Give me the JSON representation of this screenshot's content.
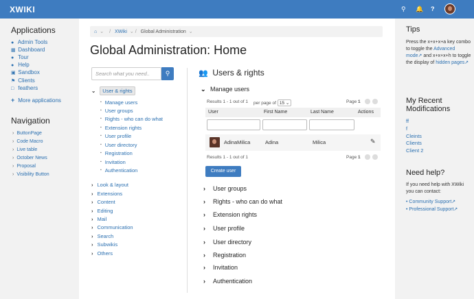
{
  "topbar": {
    "logo": "XWIKI",
    "search_icon": "search-icon",
    "bell_icon": "bell-icon",
    "help_icon": "question-icon",
    "help_label": "?"
  },
  "applications": {
    "heading": "Applications",
    "items": [
      {
        "label": "Admin Tools",
        "icon": "globe-icon"
      },
      {
        "label": "Dashboard",
        "icon": "dashboard-icon"
      },
      {
        "label": "Tour",
        "icon": "shoe-icon"
      },
      {
        "label": "Help",
        "icon": "help-icon"
      },
      {
        "label": "Sandbox",
        "icon": "sandbox-icon"
      },
      {
        "label": "Clients",
        "icon": "flag-icon"
      },
      {
        "label": "feathers",
        "icon": "document-icon"
      }
    ],
    "more": "More applications"
  },
  "navigation": {
    "heading": "Navigation",
    "items": [
      "ButtonPage",
      "Code Macro",
      "Live table",
      "October News",
      "Proposal",
      "Visibility Button"
    ]
  },
  "breadcrumb": [
    "XWiki",
    "Global Administration"
  ],
  "page_title": "Global Administration: Home",
  "search": {
    "placeholder": "Search what you need.."
  },
  "tree": {
    "selected": "User & rights",
    "children": [
      "Manage users",
      "User groups",
      "Rights - who can do what",
      "Extension rights",
      "User profile",
      "User directory",
      "Registration",
      "Invitation",
      "Authentication"
    ],
    "others": [
      "Look & layout",
      "Extensions",
      "Content",
      "Editing",
      "Mail",
      "Communication",
      "Search",
      "Subwikis",
      "Others"
    ]
  },
  "section": {
    "title": "Users & rights",
    "icon": "users-icon"
  },
  "manage_users": {
    "title": "Manage users",
    "results": "Results 1 - 1 out of 1",
    "per_page_label": "per page of",
    "per_page": "15",
    "page_label": "Page",
    "page_num": "1",
    "columns": [
      "User",
      "First Name",
      "Last Name",
      "Actions"
    ],
    "rows": [
      {
        "user": "AdinaMilica",
        "first": "Adina",
        "last": "Milica"
      }
    ],
    "create": "Create user"
  },
  "accordion": [
    "User groups",
    "Rights - who can do what",
    "Extension rights",
    "User profile",
    "User directory",
    "Registration",
    "Invitation",
    "Authentication"
  ],
  "tips": {
    "heading": "Tips",
    "text1": "Press the x+x+x+a key combo to toggle the",
    "link1": "Advanced mode",
    "text2": "and x+x+x+h to toggle the display of",
    "link2": "hidden pages"
  },
  "recent": {
    "heading": "My Recent Modifications",
    "items": [
      "ff",
      "f",
      "Cleints",
      "Clients",
      "Client 2"
    ]
  },
  "help": {
    "heading": "Need help?",
    "text": "If you need help with XWiki you can contact:",
    "links": [
      "Community Support",
      "Professional Support"
    ]
  }
}
